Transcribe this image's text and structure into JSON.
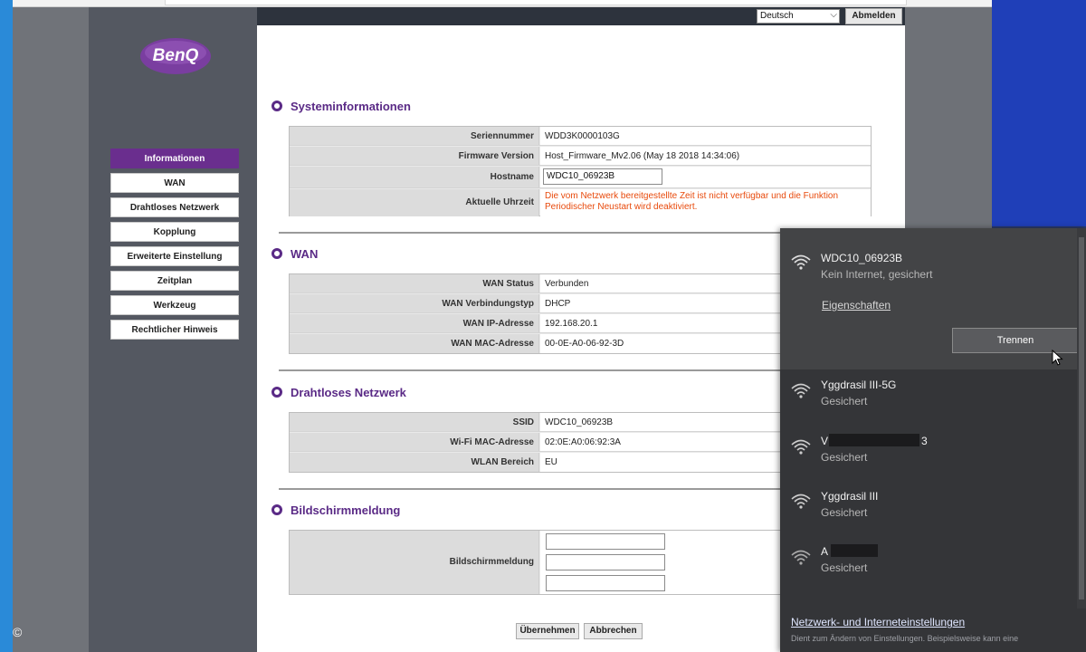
{
  "header": {
    "language": "Deutsch",
    "logout_label": "Abmelden"
  },
  "logo": {
    "text": "BenQ"
  },
  "nav": [
    "Informationen",
    "WAN",
    "Drahtloses Netzwerk",
    "Kopplung",
    "Erweiterte Einstellung",
    "Zeitplan",
    "Werkzeug",
    "Rechtlicher Hinweis"
  ],
  "system": {
    "title": "Systeminformationen",
    "serial_label": "Seriennummer",
    "serial_value": "WDD3K0000103G",
    "firmware_label": "Firmware Version",
    "firmware_value": "Host_Firmware_Mv2.06 (May 18 2018 14:34:06)",
    "hostname_label": "Hostname",
    "hostname_value": "WDC10_06923B",
    "time_label": "Aktuelle Uhrzeit",
    "time_value": "Die vom Netzwerk bereitgestellte Zeit ist nicht verfügbar und die Funktion Periodischer Neustart wird deaktiviert."
  },
  "wan": {
    "title": "WAN",
    "status_label": "WAN Status",
    "status_value": "Verbunden",
    "type_label": "WAN Verbindungstyp",
    "type_value": "DHCP",
    "ip_label": "WAN IP-Adresse",
    "ip_value": "192.168.20.1",
    "mac_label": "WAN MAC-Adresse",
    "mac_value": "00-0E-A0-06-92-3D"
  },
  "wireless": {
    "title": "Drahtloses Netzwerk",
    "ssid_label": "SSID",
    "ssid_value": "WDC10_06923B",
    "mac_label": "Wi-Fi MAC-Adresse",
    "mac_value": "02:0E:A0:06:92:3A",
    "region_label": "WLAN Bereich",
    "region_value": "EU"
  },
  "screen_message": {
    "title": "Bildschirmmeldung",
    "label": "Bildschirmmeldung"
  },
  "actions": {
    "apply": "Übernehmen",
    "cancel": "Abbrechen"
  },
  "wifi_flyout": {
    "connected": {
      "name": "WDC10_06923B",
      "status": "Kein Internet, gesichert",
      "properties_link": "Eigenschaften",
      "disconnect_button": "Trennen"
    },
    "networks": [
      {
        "name": "Yggdrasil III-5G",
        "status": "Gesichert"
      },
      {
        "name_prefix": "V",
        "name_suffix": "3",
        "status": "Gesichert"
      },
      {
        "name": "Yggdrasil III",
        "status": "Gesichert"
      },
      {
        "name_prefix": "A",
        "status": "Gesichert"
      }
    ],
    "settings_link": "Netzwerk- und Interneteinstellungen",
    "settings_desc": "Dient zum Ändern von Einstellungen. Beispielsweise kann eine"
  },
  "copyright": "©"
}
